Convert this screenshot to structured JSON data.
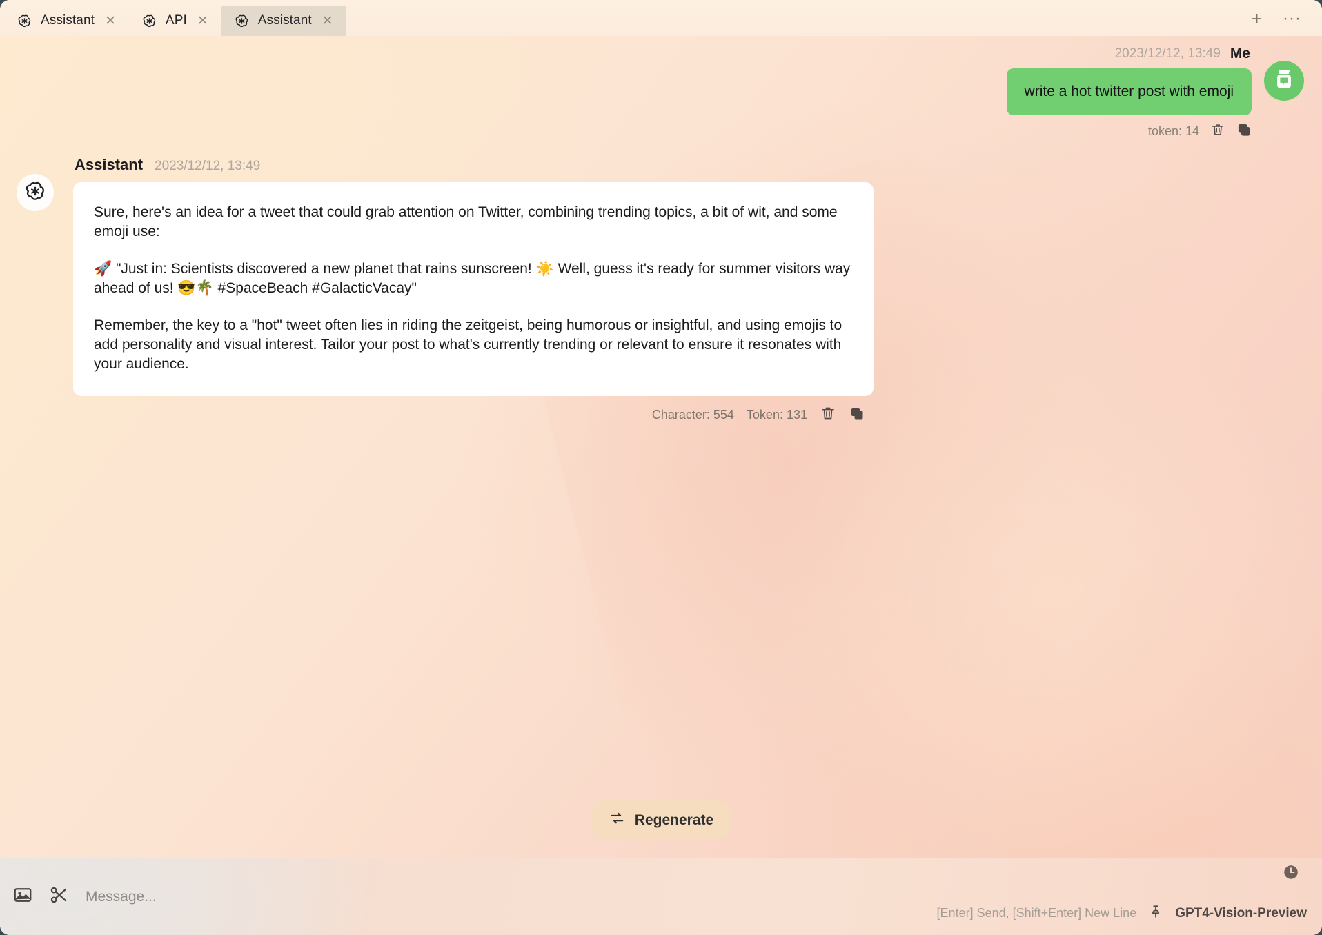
{
  "window": {
    "frame_color": "#3a4a52",
    "background_accent": "#fbe3d0"
  },
  "tabbar": {
    "tabs": [
      {
        "label": "Assistant",
        "icon": "openai-icon",
        "active": false,
        "close_label": "✕"
      },
      {
        "label": "API",
        "icon": "openai-icon",
        "active": false,
        "close_label": "✕"
      },
      {
        "label": "Assistant",
        "icon": "openai-icon",
        "active": true,
        "close_label": "✕"
      }
    ],
    "new_tab_label": "+",
    "more_label": "···"
  },
  "conversation": {
    "user_message": {
      "sender": "Me",
      "timestamp": "2023/12/12, 13:49",
      "text": "write a hot twitter post with emoji",
      "bubble_color": "#71cf71",
      "token_label": "token: 14",
      "delete_icon": "trash-icon",
      "copy_icon": "copy-icon",
      "avatar_icon": "user-avatar-icon"
    },
    "assistant_message": {
      "sender": "Assistant",
      "timestamp": "2023/12/12, 13:49",
      "avatar_icon": "openai-icon",
      "paragraphs": [
        "Sure, here's an idea for a tweet that could grab attention on Twitter, combining trending topics, a bit of wit, and some emoji use:",
        "🚀 \"Just in: Scientists discovered a new planet that rains sunscreen! ☀️ Well, guess it's ready for summer visitors way ahead of us! 😎🌴 #SpaceBeach #GalacticVacay\"",
        "Remember, the key to a \"hot\" tweet often lies in riding the zeitgeist, being humorous or insightful, and using emojis to add personality and visual interest. Tailor your post to what's currently trending or relevant to ensure it resonates with your audience."
      ],
      "character_label": "Character: 554",
      "token_label": "Token: 131",
      "delete_icon": "trash-icon",
      "copy_icon": "copy-icon"
    }
  },
  "actions": {
    "regenerate_label": "Regenerate",
    "regenerate_icon": "refresh-icon"
  },
  "composer": {
    "image_icon": "image-icon",
    "scissors_icon": "scissors-icon",
    "placeholder": "Message...",
    "value": ""
  },
  "status": {
    "hint": "[Enter] Send, [Shift+Enter] New Line",
    "pin_icon": "pin-icon",
    "model": "GPT4-Vision-Preview",
    "history_icon": "clock-icon"
  }
}
